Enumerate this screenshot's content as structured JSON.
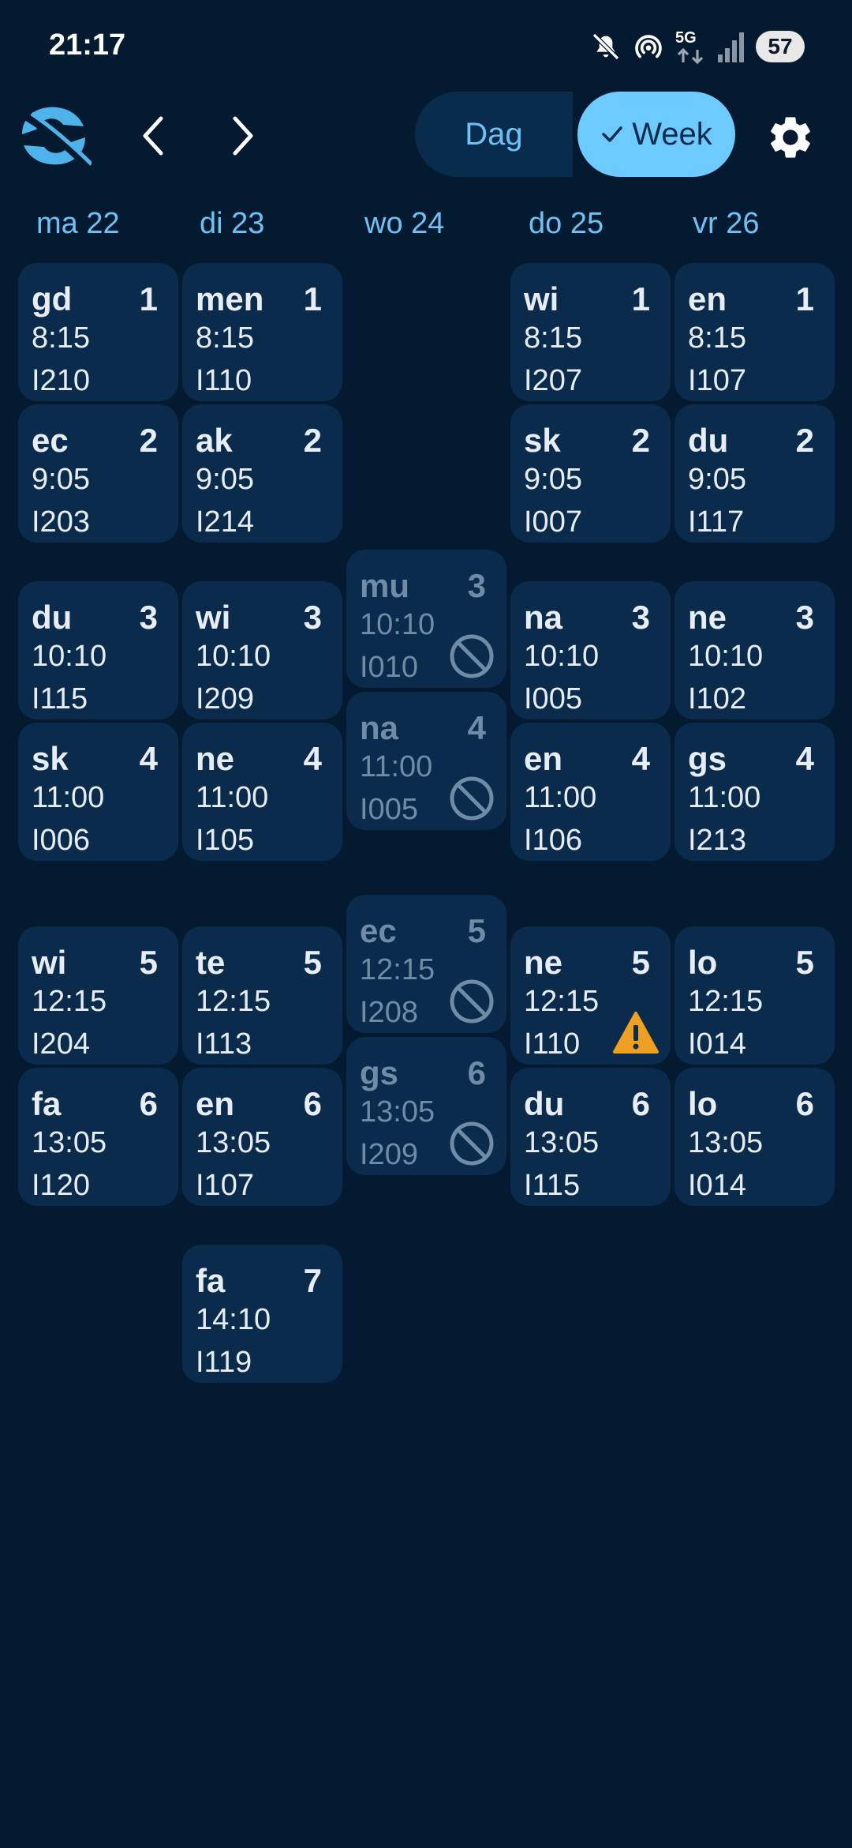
{
  "status": {
    "time": "21:17",
    "network": "5G",
    "battery": "57"
  },
  "toolbar": {
    "logo_icon": "app-logo-icon",
    "prev_icon": "chevron-left-icon",
    "next_icon": "chevron-right-icon",
    "view_options": [
      "Dag",
      "Week"
    ],
    "selected_view": "Week",
    "dag_label": "Dag",
    "week_label": "Week",
    "settings_icon": "gear-icon"
  },
  "days": [
    "ma 22",
    "di 23",
    "wo 24",
    "do 25",
    "vr 26"
  ],
  "colors": {
    "background": "#031a30",
    "card": "#0a2b4b",
    "accent": "#6ccaff",
    "day_header": "#6ec2f3",
    "cancelled_text": "#6f8ba6",
    "warning": "#f0a020"
  },
  "lessons": [
    {
      "day": "ma 22",
      "subject": "gd",
      "period": "1",
      "time": "8:15",
      "room": "I210",
      "status": "normal"
    },
    {
      "day": "di 23",
      "subject": "men",
      "period": "1",
      "time": "8:15",
      "room": "I110",
      "status": "normal"
    },
    {
      "day": "do 25",
      "subject": "wi",
      "period": "1",
      "time": "8:15",
      "room": "I207",
      "status": "normal"
    },
    {
      "day": "vr 26",
      "subject": "en",
      "period": "1",
      "time": "8:15",
      "room": "I107",
      "status": "normal"
    },
    {
      "day": "ma 22",
      "subject": "ec",
      "period": "2",
      "time": "9:05",
      "room": "I203",
      "status": "normal"
    },
    {
      "day": "di 23",
      "subject": "ak",
      "period": "2",
      "time": "9:05",
      "room": "I214",
      "status": "normal"
    },
    {
      "day": "do 25",
      "subject": "sk",
      "period": "2",
      "time": "9:05",
      "room": "I007",
      "status": "normal"
    },
    {
      "day": "vr 26",
      "subject": "du",
      "period": "2",
      "time": "9:05",
      "room": "I117",
      "status": "normal"
    },
    {
      "day": "wo 24",
      "subject": "mu",
      "period": "3",
      "time": "10:10",
      "room": "I010",
      "status": "cancelled"
    },
    {
      "day": "ma 22",
      "subject": "du",
      "period": "3",
      "time": "10:10",
      "room": "I115",
      "status": "normal"
    },
    {
      "day": "di 23",
      "subject": "wi",
      "period": "3",
      "time": "10:10",
      "room": "I209",
      "status": "normal"
    },
    {
      "day": "do 25",
      "subject": "na",
      "period": "3",
      "time": "10:10",
      "room": "I005",
      "status": "normal"
    },
    {
      "day": "vr 26",
      "subject": "ne",
      "period": "3",
      "time": "10:10",
      "room": "I102",
      "status": "normal"
    },
    {
      "day": "wo 24",
      "subject": "na",
      "period": "4",
      "time": "11:00",
      "room": "I005",
      "status": "cancelled"
    },
    {
      "day": "ma 22",
      "subject": "sk",
      "period": "4",
      "time": "11:00",
      "room": "I006",
      "status": "normal"
    },
    {
      "day": "di 23",
      "subject": "ne",
      "period": "4",
      "time": "11:00",
      "room": "I105",
      "status": "normal"
    },
    {
      "day": "do 25",
      "subject": "en",
      "period": "4",
      "time": "11:00",
      "room": "I106",
      "status": "normal"
    },
    {
      "day": "vr 26",
      "subject": "gs",
      "period": "4",
      "time": "11:00",
      "room": "I213",
      "status": "normal"
    },
    {
      "day": "wo 24",
      "subject": "ec",
      "period": "5",
      "time": "12:15",
      "room": "I208",
      "status": "cancelled"
    },
    {
      "day": "ma 22",
      "subject": "wi",
      "period": "5",
      "time": "12:15",
      "room": "I204",
      "status": "normal"
    },
    {
      "day": "di 23",
      "subject": "te",
      "period": "5",
      "time": "12:15",
      "room": "I113",
      "status": "normal"
    },
    {
      "day": "do 25",
      "subject": "ne",
      "period": "5",
      "time": "12:15",
      "room": "I110",
      "status": "warning"
    },
    {
      "day": "vr 26",
      "subject": "lo",
      "period": "5",
      "time": "12:15",
      "room": "I014",
      "status": "normal"
    },
    {
      "day": "wo 24",
      "subject": "gs",
      "period": "6",
      "time": "13:05",
      "room": "I209",
      "status": "cancelled"
    },
    {
      "day": "ma 22",
      "subject": "fa",
      "period": "6",
      "time": "13:05",
      "room": "I120",
      "status": "normal"
    },
    {
      "day": "di 23",
      "subject": "en",
      "period": "6",
      "time": "13:05",
      "room": "I107",
      "status": "normal"
    },
    {
      "day": "do 25",
      "subject": "du",
      "period": "6",
      "time": "13:05",
      "room": "I115",
      "status": "normal"
    },
    {
      "day": "vr 26",
      "subject": "lo",
      "period": "6",
      "time": "13:05",
      "room": "I014",
      "status": "normal"
    },
    {
      "day": "di 23",
      "subject": "fa",
      "period": "7",
      "time": "14:10",
      "room": "I119",
      "status": "normal"
    }
  ]
}
